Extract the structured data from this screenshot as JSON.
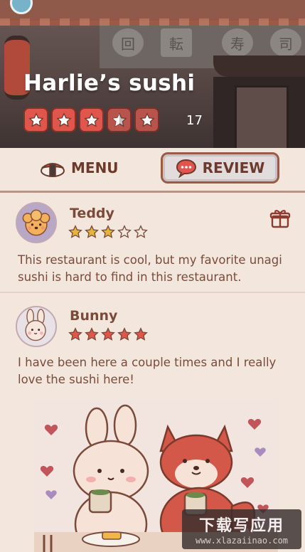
{
  "restaurant": {
    "name": "Harlie’s sushi",
    "rating_count": "17",
    "stars": [
      "full",
      "full",
      "full",
      "half",
      "full"
    ]
  },
  "tabs": {
    "menu_label": "MENU",
    "review_label": "REVIEW",
    "active": "review"
  },
  "reviews": [
    {
      "user": "Teddy",
      "stars": 3,
      "max_stars": 5,
      "text": "This restaurant is cool, but my favorite unagi sushi is hard to find in this restaurant.",
      "has_gift_icon": true
    },
    {
      "user": "Bunny",
      "stars": 5,
      "max_stars": 5,
      "text": "I have been here a couple times and I really love the sushi here!",
      "has_photo": true
    }
  ],
  "hero_kanji": [
    "回",
    "転",
    "寿",
    "司"
  ],
  "watermark": {
    "main": "下载写应用",
    "sub": "www.xlazaiinao.com"
  },
  "colors": {
    "accent_red": "#e0564c",
    "star_gold": "#e3b53c",
    "text_brown": "#7a4a3a",
    "background": "#f3e7dd",
    "tab_border": "#9c5b48"
  },
  "icons": {
    "menu": "sushi-icon",
    "review": "speech-bubble-icon",
    "gift": "gift-icon",
    "star": "star-icon"
  }
}
